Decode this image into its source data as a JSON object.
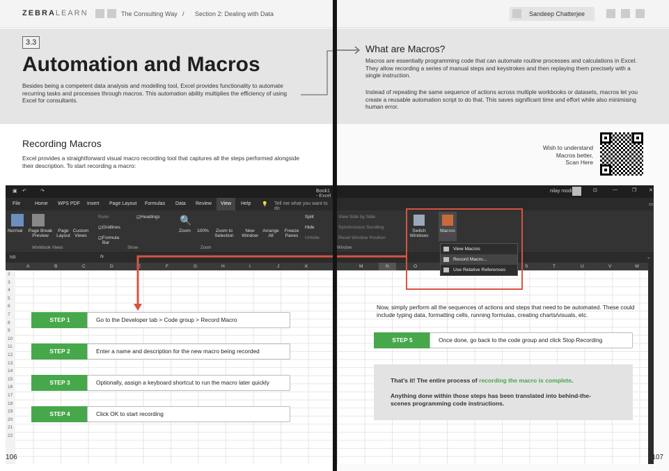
{
  "header": {
    "logo_bold": "ZEBRA",
    "logo_light": "LEARN",
    "book": "The Consulting Way",
    "separator": "/",
    "section": "Section 2: Dealing with Data",
    "user": "Sandeep Chatterjee"
  },
  "left_page": {
    "section_number": "3.3",
    "title": "Automation and Macros",
    "intro": "Besides being a competent data analysis and modelling tool, Excel provides functionality to automate recurring tasks and processes through macros. This automation ability multiplies the efficiency of using Excel for consultants.",
    "subheading": "Recording Macros",
    "subheading_text": "Excel provides a straightforward visual macro recording tool that captures all the steps performed alongside their description. To start recording a macro:",
    "page_number": "106"
  },
  "right_page": {
    "heading": "What are Macros?",
    "para1": "Macros are essentially programming code that can automate routine processes and calculations in Excel. They allow recording a series of manual steps and keystrokes and then replaying them precisely with a single instruction.",
    "para2": "Instead of repeating the same sequence of actions across multiple workbooks or datasets, macros let you create a reusable automation script to do that. This saves significant time and effort while also minimising human error.",
    "qr_caption_1": "Wish to understand",
    "qr_caption_2": "Macros better,",
    "qr_caption_3": "Scan Here",
    "grid_text": "Now, simply perform all the sequences of actions and steps that need to be automated. These could include typing data, formatting cells, running formulas, creating charts/visuals, etc.",
    "callout_line1_a": "That's it! The entire process of ",
    "callout_line1_b": "recording the macro is complete",
    "callout_line1_c": ".",
    "callout_line2": "Anything done within those steps has been translated into behind-the-scenes programming code instructions.",
    "page_number": "107"
  },
  "steps": [
    {
      "label": "STEP 1",
      "text": "Go to the Developer tab > Code group > Record Macro"
    },
    {
      "label": "STEP 2",
      "text": "Enter a name and description for the new macro being recorded"
    },
    {
      "label": "STEP 3",
      "text": "Optionally, assign a keyboard shortcut to run the macro later quickly"
    },
    {
      "label": "STEP 4",
      "text": "Click OK to start recording"
    },
    {
      "label": "STEP 5",
      "text": "Once done, go back to the code group and click Stop Recording"
    }
  ],
  "excel": {
    "title": "Book1 - Excel",
    "user": "nilay modi",
    "tabs": [
      "File",
      "Home",
      "WPS PDF",
      "Insert",
      "Page Layout",
      "Formulas",
      "Data",
      "Review",
      "View",
      "Help"
    ],
    "tell_me": "Tell me what you want to do",
    "ribbon": {
      "normal": "Normal",
      "page_break": "Page Break Preview",
      "page_layout": "Page Layout",
      "custom_views": "Custom Views",
      "workbook_views": "Workbook Views",
      "ruler": "Ruler",
      "gridlines": "Gridlines",
      "formula_bar": "Formula Bar",
      "headings": "Headings",
      "show": "Show",
      "zoom": "Zoom",
      "hundred": "100%",
      "zoom_selection": "Zoom to Selection",
      "zoom_group": "Zoom",
      "new_window": "New Window",
      "arrange_all": "Arrange All",
      "freeze_panes": "Freeze Panes",
      "split": "Split",
      "hide": "Hide",
      "unhide": "Unhide",
      "window_group": "Window",
      "view_side": "View Side by Side",
      "sync_scroll": "Synchronous Scrolling",
      "reset_pos": "Reset Window Position",
      "switch_windows": "Switch Windows",
      "macros": "Macros"
    },
    "name_box": "N9",
    "fx": "fx",
    "columns_left": [
      "A",
      "B",
      "C",
      "D",
      "E",
      "F",
      "G",
      "H",
      "I",
      "J",
      "K"
    ],
    "columns_right": [
      "M",
      "N",
      "O",
      "P",
      "Q",
      "R",
      "S",
      "T",
      "U",
      "V",
      "W"
    ],
    "rows": [
      "2",
      "3",
      "4",
      "5",
      "6",
      "7",
      "8",
      "9",
      "10",
      "11",
      "12",
      "13",
      "14",
      "15",
      "16",
      "17",
      "18",
      "19",
      "20",
      "21",
      "22"
    ],
    "macro_menu": [
      "View Macros",
      "Record Macro...",
      "Use Relative References"
    ]
  },
  "colors": {
    "accent_green": "#47a84b",
    "highlight_red": "#d9533f"
  }
}
